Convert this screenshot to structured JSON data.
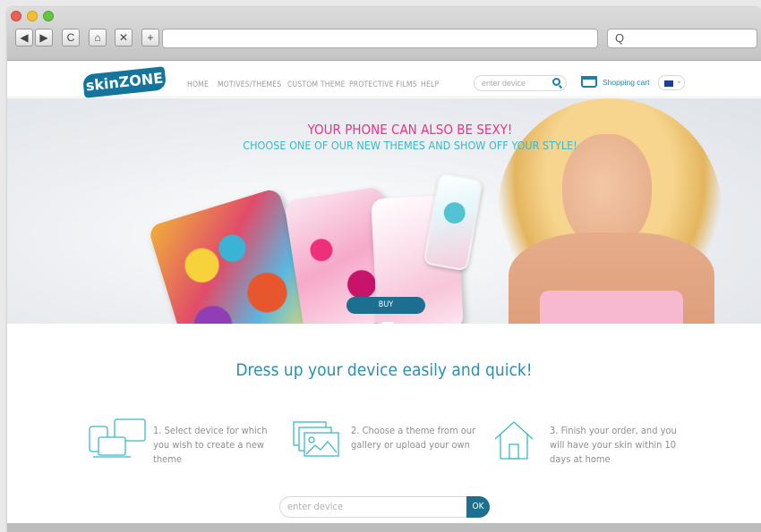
{
  "browser": {
    "url": "",
    "search_icon_glyph": "Q",
    "buttons": {
      "back": "◀",
      "forward": "▶",
      "reload": "C",
      "home": "⌂",
      "stop": "✕",
      "new_tab": "+"
    }
  },
  "nav": {
    "logo": "skinZONE",
    "items": [
      "HOME",
      "MOTIVES/THEMES",
      "CUSTOM THEME",
      "PROTECTIVE FILMS",
      "HELP"
    ],
    "search_placeholder": "enter device",
    "cart_label": "Shopping cart",
    "language": "EU"
  },
  "hero": {
    "headline1": "YOUR PHONE CAN ALSO BE SEXY!",
    "headline2": "CHOOSE ONE OF OUR NEW THEMES AND SHOW OFF YOUR STYLE!",
    "buy_label": "BUY"
  },
  "main": {
    "title": "Dress up your device easily and quick!",
    "steps": [
      {
        "text": "1. Select device for which you wish to create a new theme",
        "icon": "devices-icon"
      },
      {
        "text": "2. Choose a theme from our gallery or upload your own",
        "icon": "gallery-icon"
      },
      {
        "text": "3. Finish your order, and you will have your skin within 10 days at home",
        "icon": "home-icon"
      }
    ],
    "device_input_placeholder": "enter device",
    "ok_label": "OK"
  },
  "colors": {
    "accent": "#1c6f8e",
    "pink": "#e63487",
    "teal": "#3bb8c8",
    "title": "#2a8fb1"
  }
}
